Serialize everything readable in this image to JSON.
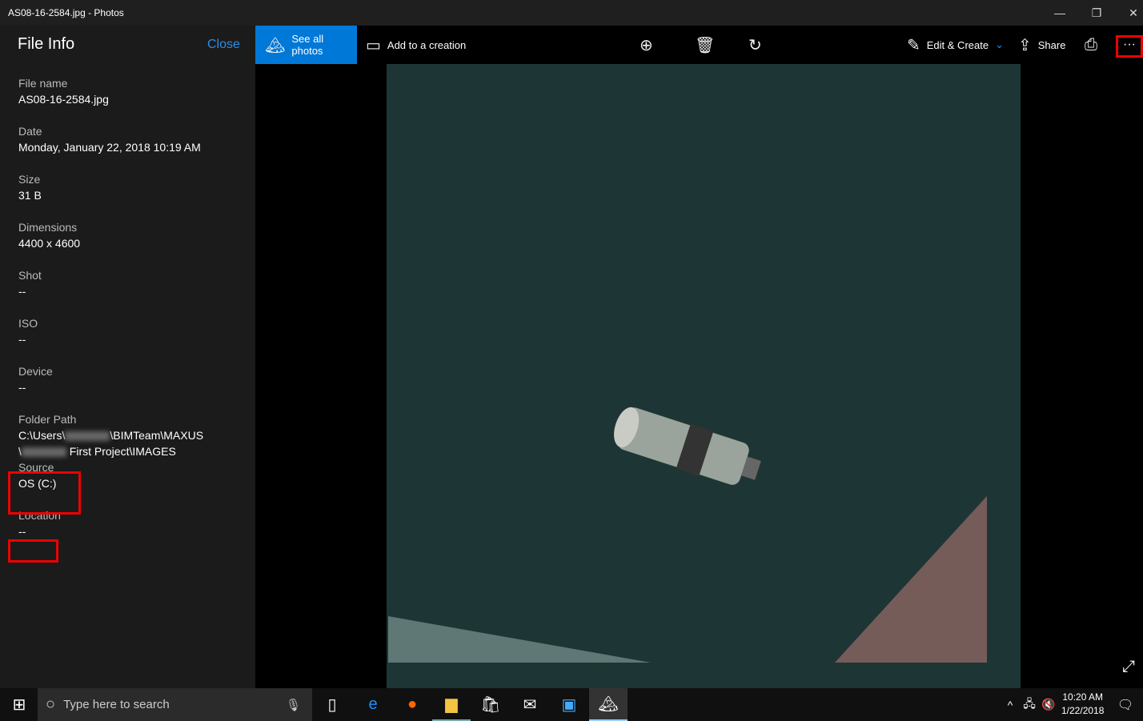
{
  "window": {
    "title": "AS08-16-2584.jpg - Photos",
    "minimize": "—",
    "restore": "❐",
    "close": "✕"
  },
  "panel": {
    "title": "File Info",
    "close_label": "Close",
    "fields": [
      {
        "label": "File name",
        "value": "AS08-16-2584.jpg"
      },
      {
        "label": "Date",
        "value": "Monday, January 22, 2018 10:19 AM"
      },
      {
        "label": "Size",
        "value": "31 B"
      },
      {
        "label": "Dimensions",
        "value": "4400 x 4600"
      },
      {
        "label": "Shot",
        "value": "--"
      },
      {
        "label": "ISO",
        "value": "--"
      },
      {
        "label": "Device",
        "value": "--"
      },
      {
        "label": "Folder Path",
        "line1a": "C:\\Users\\",
        "line1b": "\\BIMTeam\\MAXUS",
        "line2a": "\\",
        "line2b": " First Project\\IMAGES"
      },
      {
        "label": "Source",
        "value": "OS (C:)"
      },
      {
        "label": "Location",
        "value": "--"
      }
    ]
  },
  "toolbar": {
    "see_all": "See all photos",
    "add_creation": "Add to a creation",
    "edit_create": "Edit & Create",
    "share": "Share"
  },
  "taskbar": {
    "search_placeholder": "Type here to search",
    "time": "10:20 AM",
    "date": "1/22/2018"
  },
  "colors": {
    "accent": "#0078d7",
    "highlight": "#e00000"
  }
}
